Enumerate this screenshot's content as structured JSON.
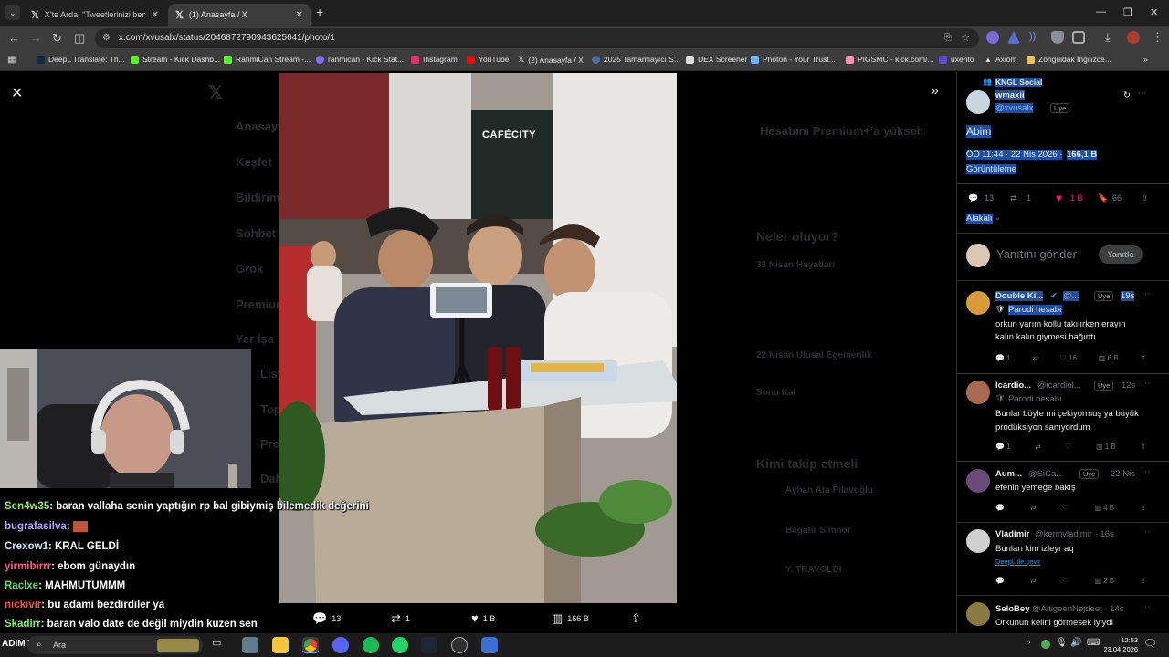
{
  "browser": {
    "tabs": [
      {
        "label": "X'te Arda: \"Tweetlerinizi ben sil",
        "active": false
      },
      {
        "label": "(1) Anasayfa / X",
        "active": true
      }
    ],
    "url": "x.com/xvusalx/status/2046872790943625641/photo/1",
    "bookmarks": [
      "DeepL Translate: Th...",
      "Stream - Kick Dashb...",
      "RahmiCan Stream -...",
      "rahmican - Kick Stat...",
      "Instagram",
      "YouTube",
      "(2) Anasayfa / X",
      "2025 Tamamlayıcı S...",
      "DEX Screener",
      "Photon - Your Trust...",
      "PIGSMC - kick.com/...",
      "uxento",
      "Axiom",
      "Zonguldak İngilizce..."
    ]
  },
  "background_nav": {
    "items": [
      "Anasayfa",
      "Keşfet",
      "Bildirim",
      "Sohbet",
      "Grok",
      "Premium",
      "Yer İşa",
      "Liste",
      "Toplulu",
      "Profil",
      "Daha fa"
    ],
    "right_cards": [
      "Hesabını Premium+'a yükselt",
      "Neler oluyor?",
      "33 Nisan Hayatları",
      "22 Nisan Ulusal Egemenlik",
      "Sonu Kal",
      "Kimi takip etmeli",
      "Ayhan Ata Pilavoğlu",
      "Bagatir Simnor",
      "Y. TRAVOLDI"
    ]
  },
  "photo_bar": {
    "replies": "13",
    "reposts": "1",
    "likes": "1 B",
    "views": "166 B"
  },
  "post": {
    "context": "KNGL Social",
    "name": "wmaxii",
    "handle": "@xvusalx",
    "member_badge": "Üye",
    "text": "Abim",
    "meta_time": "ÖÖ 11:44 · 22 Nis 2026 ·",
    "meta_views": "166,1 B",
    "meta_views_label": "Görüntüleme",
    "stats": {
      "replies": "13",
      "reposts": "1",
      "likes": "1 B",
      "bookmarks": "66"
    },
    "relevant_label": "Alakalı",
    "reply_placeholder": "Yanıtını gönder",
    "reply_button": "Yanıtla"
  },
  "replies": [
    {
      "name": "Double Ki...",
      "handle": "@...",
      "badge": "Üye",
      "time": "19s",
      "tag": "Parodi hesabı",
      "text": [
        "orkun yarım kollu takılırken erayın",
        "kalın kalın giymesi bağırttı"
      ],
      "stats": {
        "replies": "1",
        "reposts": "",
        "likes": "16",
        "views": "6 B"
      }
    },
    {
      "name": "İcardio...",
      "handle": "@icardiol...",
      "badge": "Üye",
      "time": "12s",
      "tag": "Parodi hesabı",
      "text": [
        "Bunlar böyle mi çekiyormuş ya büyük",
        "prodüksiyon sanıyordum"
      ],
      "stats": {
        "replies": "1",
        "reposts": "",
        "likes": "",
        "views": "1 B"
      }
    },
    {
      "name": "Aum...",
      "handle": "@SiCa...",
      "badge": "Üye",
      "time": "22 Nis",
      "tag": "",
      "text": [
        "efenin yemeğe bakış"
      ],
      "stats": {
        "replies": "",
        "reposts": "",
        "likes": "",
        "views": "4 B"
      }
    },
    {
      "name": "Vladimir",
      "handle": "@kennvladimir · 16s",
      "badge": "",
      "time": "",
      "tag": "",
      "text": [
        "Bunları kim izleyr aq"
      ],
      "translate": "DeepL ile çevir",
      "stats": {
        "replies": "",
        "reposts": "",
        "likes": "",
        "views": "2 B"
      }
    },
    {
      "name": "SeloBey",
      "handle": "@AltigeenNejdeet · 14s",
      "badge": "",
      "time": "",
      "tag": "",
      "text": [
        "Orkunun kelini görmesek iyiydi"
      ],
      "stats": {
        "replies": "",
        "reposts": "",
        "likes": "",
        "views": ""
      }
    }
  ],
  "photo_overlay": {
    "sign": "CAFÉCITY"
  },
  "chat": [
    {
      "user": "Sen4w35",
      "color": "#9fe870",
      "msg": ": baran vallaha senin yaptığın rp bal gibiymiş bilemedik değerini"
    },
    {
      "user": "bugrafasilva",
      "color": "#b9a7ff",
      "msg": ":"
    },
    {
      "user": "Crexow1",
      "color": "#d7ecff",
      "msg": ": KRAL GELDİ"
    },
    {
      "user": "yirmibirrr",
      "color": "#ff5a8a",
      "msg": ": ebom günaydın"
    },
    {
      "user": "Raclxe",
      "color": "#53e26b",
      "msg": ": MAHMUTUMMM"
    },
    {
      "user": "nickivir",
      "color": "#ff4d4d",
      "msg": ": bu adami bezdirdiler ya"
    },
    {
      "user": "Skadirr",
      "color": "#7bf06b",
      "msg": ": baran valo date de değil miydin kuzen sen"
    }
  ],
  "taskbar": {
    "search": "Ara",
    "ticker": "ADIM TEST",
    "time": "12:53",
    "date": "23.04.2026"
  },
  "colors": {
    "x_blue": "#1d9bf0",
    "like_pink": "#f91880",
    "highlight": "#1d4fa3"
  }
}
